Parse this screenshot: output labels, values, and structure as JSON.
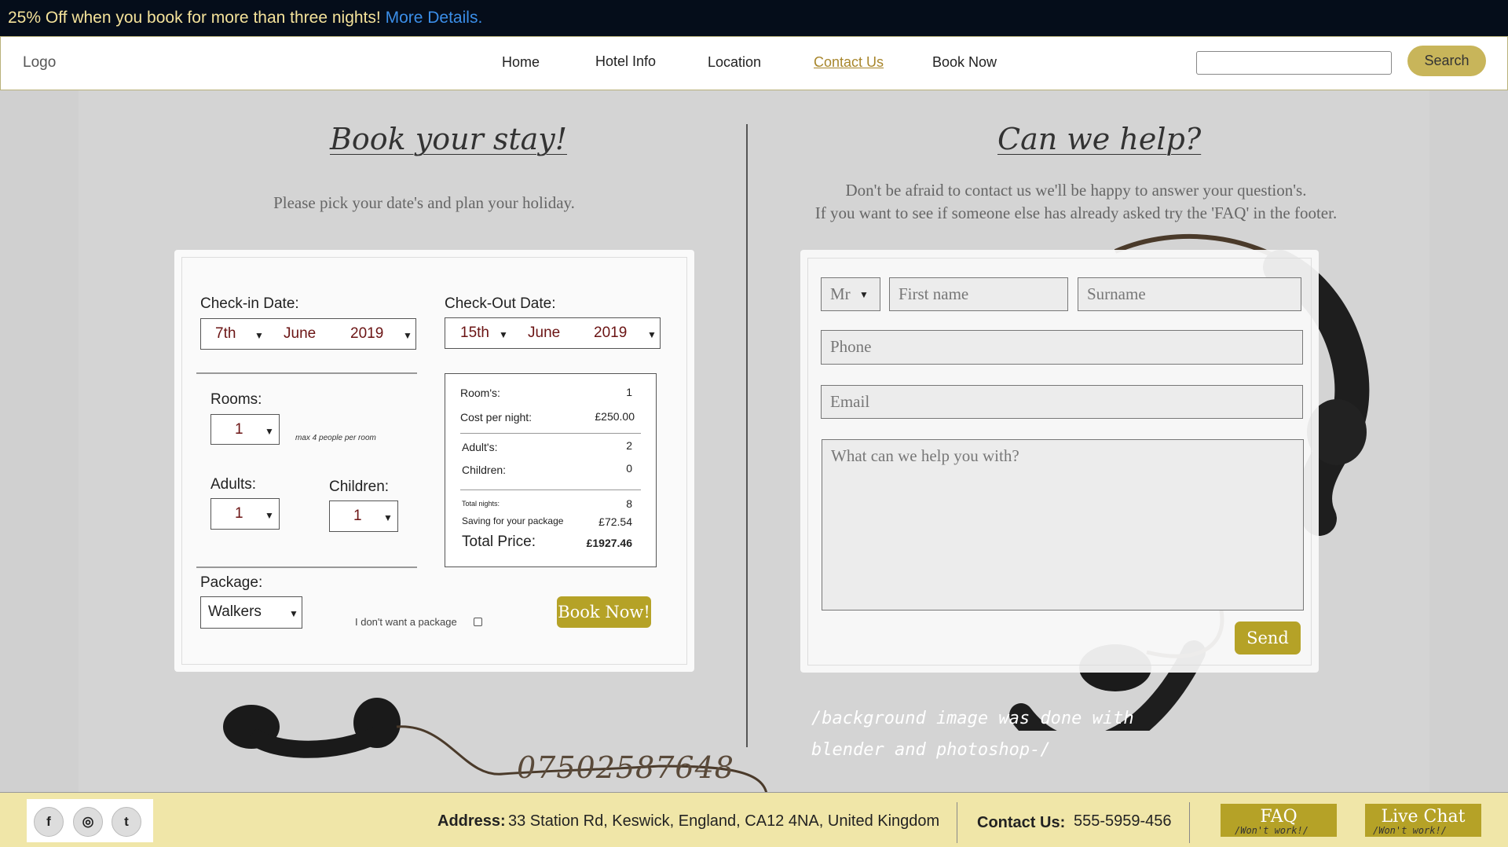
{
  "promo": {
    "text": "25% Off when you book for more than three nights!",
    "link": "More Details."
  },
  "nav": {
    "logo": "Logo",
    "links": [
      "Home",
      "Hotel Info",
      "Location",
      "Contact Us",
      "Book Now"
    ],
    "active": "Contact Us",
    "search_label": "Search"
  },
  "booking": {
    "title": "Book your stay!",
    "subtitle": "Please pick your date's and plan your holiday.",
    "checkin_label": "Check-in Date:",
    "checkin": {
      "day": "7th",
      "month": "June",
      "year": "2019"
    },
    "checkout_label": "Check-Out Date:",
    "checkout": {
      "day": "15th",
      "month": "June",
      "year": "2019"
    },
    "rooms_label": "Rooms:",
    "rooms": "1",
    "max_note": "max 4 people per room",
    "adults_label": "Adults:",
    "adults": "1",
    "children_label": "Children:",
    "children": "1",
    "package_label": "Package:",
    "package": "Walkers",
    "no_package_label": "I don't want a package",
    "book_button": "Book Now!",
    "summary": {
      "rooms_label": "Room's:",
      "rooms": "1",
      "cost_label": "Cost per night:",
      "cost": "£250.00",
      "adults_label": "Adult's:",
      "adults": "2",
      "children_label": "Children:",
      "children": "0",
      "nights_label": "Total nights:",
      "nights": "8",
      "saving_label": "Saving for your package",
      "saving": "£72.54",
      "total_label": "Total Price:",
      "total": "£1927.46"
    }
  },
  "contact": {
    "title": "Can we help?",
    "subtitle_1": "Don't be afraid to contact us we'll be happy to answer your question's.",
    "subtitle_2": "If you want to see if someone else has already asked try the 'FAQ' in the footer.",
    "title_select": "Mr",
    "first_name_placeholder": "First name",
    "surname_placeholder": "Surname",
    "phone_placeholder": "Phone",
    "email_placeholder": "Email",
    "message_placeholder": "What can we help you with?",
    "send_button": "Send"
  },
  "note": {
    "line1": "/background image was done with",
    "line2": "blender and photoshop-/"
  },
  "phone_number": "07502587648",
  "footer": {
    "address_label": "Address:",
    "address": "33 Station Rd, Keswick, England, CA12 4NA, United Kingdom",
    "contact_label": "Contact Us:",
    "contact": "555-5959-456",
    "faq": "FAQ",
    "faq_hint": "/Won't work!/",
    "chat": "Live Chat",
    "chat_hint": "/Won't work!/",
    "social": [
      "f",
      "◎",
      "t"
    ]
  },
  "colors": {
    "accent": "#b5a227",
    "promo_bg": "#050d1a",
    "footer_bg": "#f0e6a8",
    "link": "#3b8ee8"
  }
}
